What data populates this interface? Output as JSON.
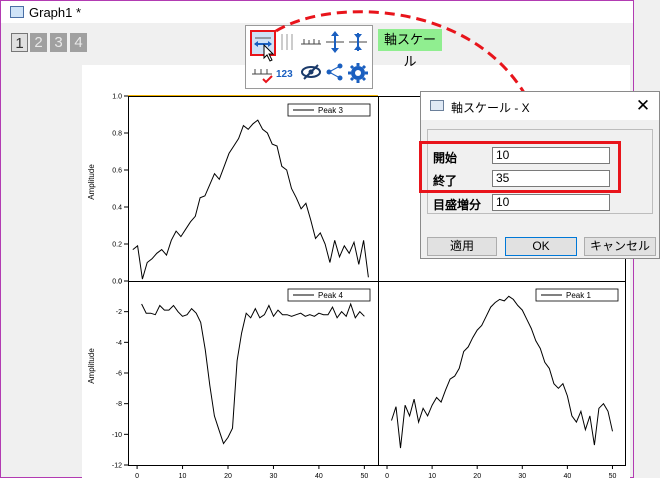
{
  "window": {
    "title": "Graph1 *",
    "layer_tabs": [
      "1",
      "2",
      "3",
      "4"
    ]
  },
  "toolbar": {
    "tooltip_label": "軸スケール",
    "buttons": [
      "rescale-x-icon",
      "grid-icon",
      "x-scale-icon",
      "rescale-y-icon",
      "y-scale-icon",
      "axis-tick-icon",
      "tick-labels-icon",
      "hide-icon",
      "connect-icon",
      "settings-icon"
    ]
  },
  "dialog": {
    "title": "軸スケール - X",
    "close": "✕",
    "fields": [
      {
        "label": "開始",
        "value": "10"
      },
      {
        "label": "終了",
        "value": "35"
      },
      {
        "label": "目盛増分",
        "value": "10"
      }
    ],
    "buttons": {
      "apply": "適用",
      "ok": "OK",
      "cancel": "キャンセル"
    }
  },
  "colors": {
    "highlight": "#e8141b",
    "window_border": "#b23bb2",
    "tooltip_bg": "#90ee90",
    "axis_accent": "#f2b400"
  },
  "chart_data": [
    {
      "type": "line",
      "panel": "top-left",
      "legend": "Peak 3",
      "ylabel": "Amplitude",
      "yticks": [
        "1.0",
        "0.8",
        "0.6",
        "0.4",
        "0.2",
        "0.0"
      ],
      "ylim": [
        0,
        1.0
      ],
      "xlim": [
        0,
        52
      ],
      "x": [
        1,
        2,
        3,
        4,
        5,
        6,
        7,
        8,
        9,
        10,
        11,
        12,
        13,
        14,
        15,
        16,
        17,
        18,
        19,
        20,
        21,
        22,
        23,
        24,
        25,
        26,
        27,
        28,
        29,
        30,
        31,
        32,
        33,
        34,
        35,
        36,
        37,
        38,
        39,
        40,
        41,
        42,
        43,
        44,
        45,
        46,
        47,
        48,
        49,
        50
      ],
      "y": [
        0.17,
        0.19,
        0.01,
        0.1,
        0.12,
        0.15,
        0.17,
        0.14,
        0.22,
        0.27,
        0.24,
        0.28,
        0.32,
        0.35,
        0.45,
        0.46,
        0.52,
        0.58,
        0.55,
        0.62,
        0.69,
        0.73,
        0.77,
        0.84,
        0.82,
        0.85,
        0.87,
        0.82,
        0.8,
        0.74,
        0.73,
        0.62,
        0.6,
        0.5,
        0.45,
        0.39,
        0.42,
        0.33,
        0.23,
        0.26,
        0.2,
        0.1,
        0.22,
        0.13,
        0.19,
        0.15,
        0.21,
        0.09,
        0.22,
        0.02
      ]
    },
    {
      "type": "line",
      "panel": "bottom-left",
      "legend": "Peak 4",
      "ylabel": "Amplitude",
      "yticks": [
        "0",
        "-2",
        "-4",
        "-6",
        "-8",
        "-10",
        "-12"
      ],
      "ylim": [
        -12,
        0
      ],
      "xticks": [
        "0",
        "10",
        "20",
        "30",
        "40",
        "50"
      ],
      "xlim": [
        -2,
        53
      ],
      "x": [
        1,
        2,
        3,
        4,
        5,
        6,
        7,
        8,
        9,
        10,
        11,
        12,
        13,
        14,
        15,
        16,
        17,
        18,
        19,
        20,
        21,
        22,
        23,
        24,
        25,
        26,
        27,
        28,
        29,
        30,
        31,
        32,
        33,
        34,
        35,
        36,
        37,
        38,
        39,
        40,
        41,
        42,
        43,
        44,
        45,
        46,
        47,
        48,
        49,
        50
      ],
      "y": [
        -1.5,
        -2.1,
        -2.1,
        -2.2,
        -1.6,
        -1.9,
        -1.9,
        -1.6,
        -2.0,
        -2.3,
        -2.2,
        -1.8,
        -2.1,
        -2.7,
        -4.5,
        -6.8,
        -8.8,
        -9.7,
        -10.6,
        -10.2,
        -9.6,
        -5.2,
        -3.4,
        -2.1,
        -2.4,
        -1.8,
        -2.4,
        -2.2,
        -1.6,
        -2.3,
        -1.9,
        -2.2,
        -2.2,
        -2.3,
        -2.2,
        -2.1,
        -2.3,
        -2.2,
        -2.3,
        -2.1,
        -2.2,
        -2.2,
        -1.7,
        -2.4,
        -2.0,
        -2.3,
        -1.5,
        -2.4,
        -2.0,
        -2.3
      ]
    },
    {
      "type": "line",
      "panel": "bottom-right",
      "legend": "Peak 1",
      "xticks": [
        "0",
        "10",
        "20",
        "30",
        "40",
        "50"
      ],
      "xlim": [
        -2,
        53
      ],
      "x": [
        1,
        2,
        3,
        4,
        5,
        6,
        7,
        8,
        9,
        10,
        11,
        12,
        13,
        14,
        15,
        16,
        17,
        18,
        19,
        20,
        21,
        22,
        23,
        24,
        25,
        26,
        27,
        28,
        29,
        30,
        31,
        32,
        33,
        34,
        35,
        36,
        37,
        38,
        39,
        40,
        41,
        42,
        43,
        44,
        45,
        46,
        47,
        48,
        49,
        50
      ],
      "y": [
        -9.1,
        -8.2,
        -10.9,
        -8.1,
        -8.8,
        -7.7,
        -9.2,
        -8.3,
        -8.8,
        -8.1,
        -7.6,
        -7.9,
        -7.1,
        -6.4,
        -6.2,
        -5.7,
        -4.6,
        -4.3,
        -3.7,
        -3.2,
        -2.9,
        -2.3,
        -1.7,
        -1.4,
        -1.2,
        -1.3,
        -1.0,
        -1.2,
        -1.6,
        -1.9,
        -2.5,
        -3.1,
        -3.9,
        -4.4,
        -5.3,
        -5.7,
        -6.7,
        -7.0,
        -6.7,
        -7.5,
        -8.8,
        -9.2,
        -8.5,
        -9.7,
        -8.8,
        -10.7,
        -8.3,
        -8.0,
        -8.5,
        -9.8
      ],
      "ylim": [
        -12,
        0
      ]
    }
  ]
}
